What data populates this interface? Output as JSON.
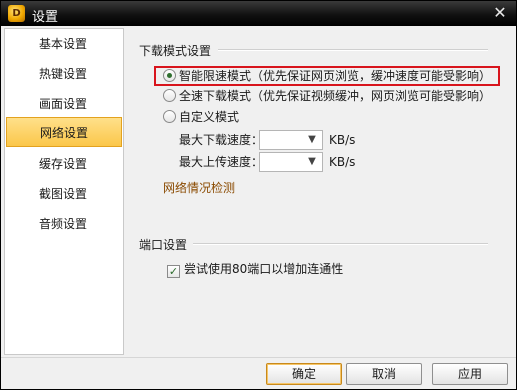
{
  "window": {
    "title": "设置",
    "app_icon_letter": "D",
    "close_glyph": "✕"
  },
  "sidebar": {
    "items": [
      {
        "label": "基本设置",
        "active": false
      },
      {
        "label": "热键设置",
        "active": false
      },
      {
        "label": "画面设置",
        "active": false
      },
      {
        "label": "网络设置",
        "active": true
      },
      {
        "label": "缓存设置",
        "active": false
      },
      {
        "label": "截图设置",
        "active": false
      },
      {
        "label": "音频设置",
        "active": false
      }
    ]
  },
  "download_mode": {
    "title": "下载模式设置",
    "options": [
      {
        "label": "智能限速模式（优先保证网页浏览，缓冲速度可能受影响）",
        "selected": true
      },
      {
        "label": "全速下载模式（优先保证视频缓冲，网页浏览可能受影响）",
        "selected": false
      },
      {
        "label": "自定义模式",
        "selected": false
      }
    ],
    "max_download_label": "最大下载速度：",
    "max_download_value": "",
    "max_upload_label": "最大上传速度：",
    "max_upload_value": "",
    "unit": "KB/s",
    "network_check_link": "网络情况检测"
  },
  "port": {
    "title": "端口设置",
    "try_port80_label": "尝试使用80端口以增加连通性",
    "try_port80_checked": true
  },
  "footer": {
    "ok": "确定",
    "cancel": "取消",
    "apply": "应用"
  },
  "colors": {
    "highlight_border": "#d8141c",
    "active_item": "#fbc74a",
    "link": "#8a4a00"
  }
}
